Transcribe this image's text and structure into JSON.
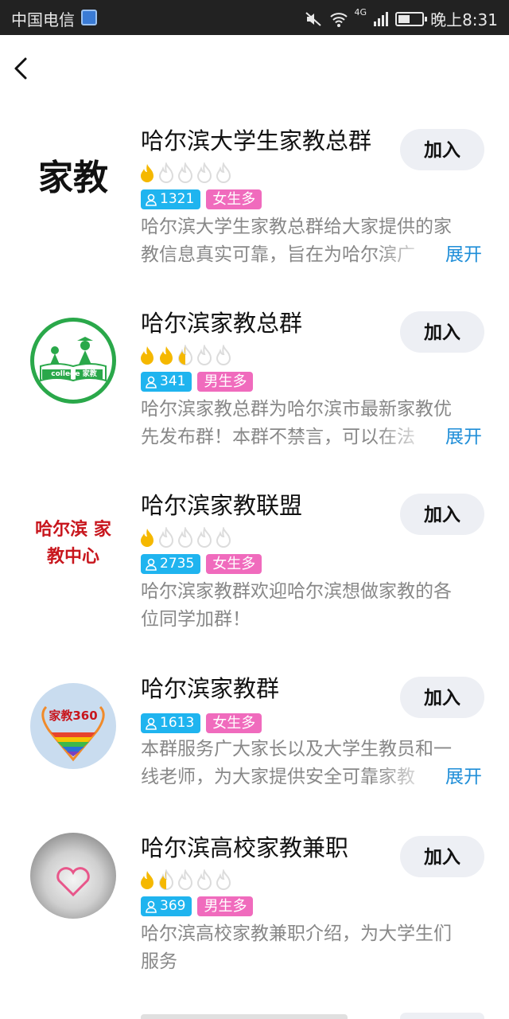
{
  "status_bar": {
    "carrier": "中国电信",
    "network": "4G",
    "time": "晚上8:31"
  },
  "nav": {
    "back_icon": "chevron-left-icon"
  },
  "colors": {
    "join_bg": "#edeff4",
    "count_tag": "#1fb4ef",
    "gender_tag": "#f06bbd",
    "expand": "#1f8ed8",
    "flame_on": "#f5b800",
    "flame_off": "#dcdcdc"
  },
  "groups": [
    {
      "name": "哈尔滨大学生家教总群",
      "heat": 1,
      "members": "1321",
      "gender": "女生多",
      "avatar_text": "家教",
      "desc_lines": [
        "哈尔滨大学生家教总群给大家提供的家",
        "教信息真实可靠，旨在为哈尔滨广"
      ],
      "expand": "展开",
      "join": "加入"
    },
    {
      "name": "哈尔滨家教总群",
      "heat": 2.5,
      "members": "341",
      "gender": "男生多",
      "avatar_text": "college 家教",
      "desc_lines": [
        "哈尔滨家教总群为哈尔滨市最新家教优",
        "先发布群！本群不禁言，可以在法"
      ],
      "expand": "展开",
      "join": "加入"
    },
    {
      "name": "哈尔滨家教联盟",
      "heat": 1,
      "members": "2735",
      "gender": "女生多",
      "avatar_text": "哈尔滨 家教中心",
      "desc_lines": [
        "哈尔滨家教群欢迎哈尔滨想做家教的各",
        "位同学加群！"
      ],
      "expand": "",
      "join": "加入"
    },
    {
      "name": "哈尔滨家教群",
      "heat": 0,
      "members": "1613",
      "gender": "女生多",
      "avatar_text": "家教360",
      "desc_lines": [
        "本群服务广大家长以及大学生教员和一",
        "线老师，为大家提供安全可靠家教"
      ],
      "expand": "展开",
      "join": "加入"
    },
    {
      "name": "哈尔滨高校家教兼职",
      "heat": 1.5,
      "members": "369",
      "gender": "男生多",
      "avatar_text": "",
      "desc_lines": [
        "哈尔滨高校家教兼职介绍，为大学生们",
        "服务"
      ],
      "expand": "",
      "join": "加入"
    }
  ]
}
